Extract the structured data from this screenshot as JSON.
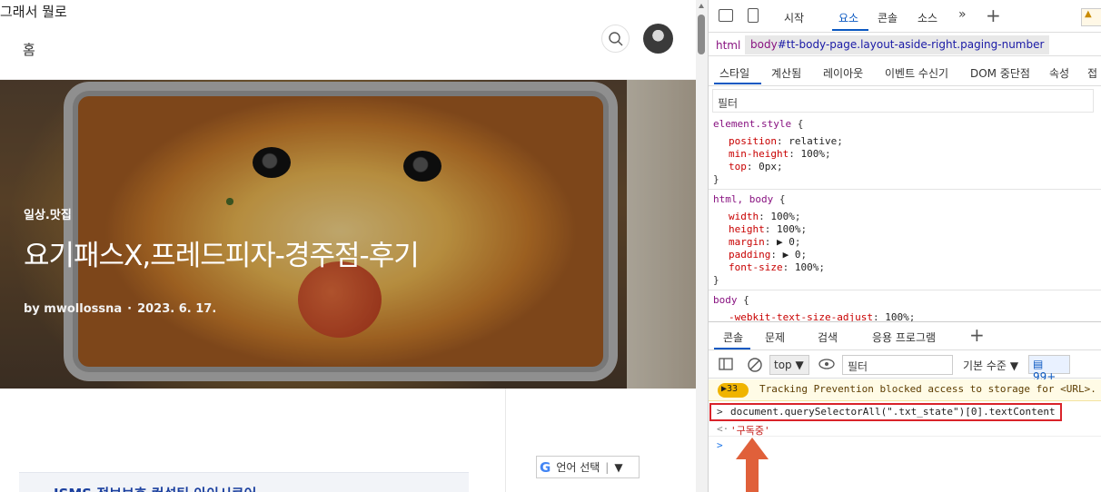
{
  "blog": {
    "site_title": "그래서 뭘로",
    "nav_home": "홈",
    "category": "일상.맛집",
    "post_title": "요기패스X,프레드피자-경주점-후기",
    "author": "by mwollossna",
    "date": "2023. 6. 17.",
    "language_select": "언어 선택",
    "card_title": "ISMS 정보보호 컨설팅 아이시큐어"
  },
  "devtools": {
    "tabs": [
      "시작",
      "요소",
      "콘솔",
      "소스"
    ],
    "active_tab": "요소",
    "warning_badge": "▲",
    "breadcrumb_html": "html",
    "breadcrumb_body": "body",
    "breadcrumb_body_selector": "#tt-body-page.layout-aside-right.paging-number",
    "subtabs": [
      "스타일",
      "계산됨",
      "레이아웃",
      "이벤트 수신기",
      "DOM 중단점",
      "속성",
      "접"
    ],
    "filter_placeholder": "필터",
    "styles": [
      {
        "selector": "element.style",
        "brace": "{",
        "props": [
          [
            "position",
            "relative"
          ],
          [
            "min-height",
            "100%"
          ],
          [
            "top",
            "0px"
          ]
        ]
      },
      {
        "selector": "html, body",
        "brace": "{",
        "props": [
          [
            "width",
            "100%"
          ],
          [
            "height",
            "100%"
          ],
          [
            "margin",
            "▶ 0"
          ],
          [
            "padding",
            "▶ 0"
          ],
          [
            "font-size",
            "100%"
          ]
        ]
      },
      {
        "selector": "body",
        "brace": "{",
        "props": [
          [
            "-webkit-text-size-adjust",
            "100%"
          ]
        ]
      }
    ],
    "console_tabs": [
      "콘솔",
      "문제",
      "검색",
      "응용 프로그램"
    ],
    "console_context": "top",
    "console_filter_placeholder": "필터",
    "log_level": "기본 수준",
    "issues_count": "99+",
    "warning_count": "33",
    "warning_message": "Tracking Prevention blocked access to storage for <URL>.",
    "command": "document.querySelectorAll(\".txt_state\")[0].textContent",
    "result": "'구독중'",
    "accent_color": "#0a58c2",
    "highlight_color": "#d9232a",
    "arrow_color": "#e0603a"
  }
}
